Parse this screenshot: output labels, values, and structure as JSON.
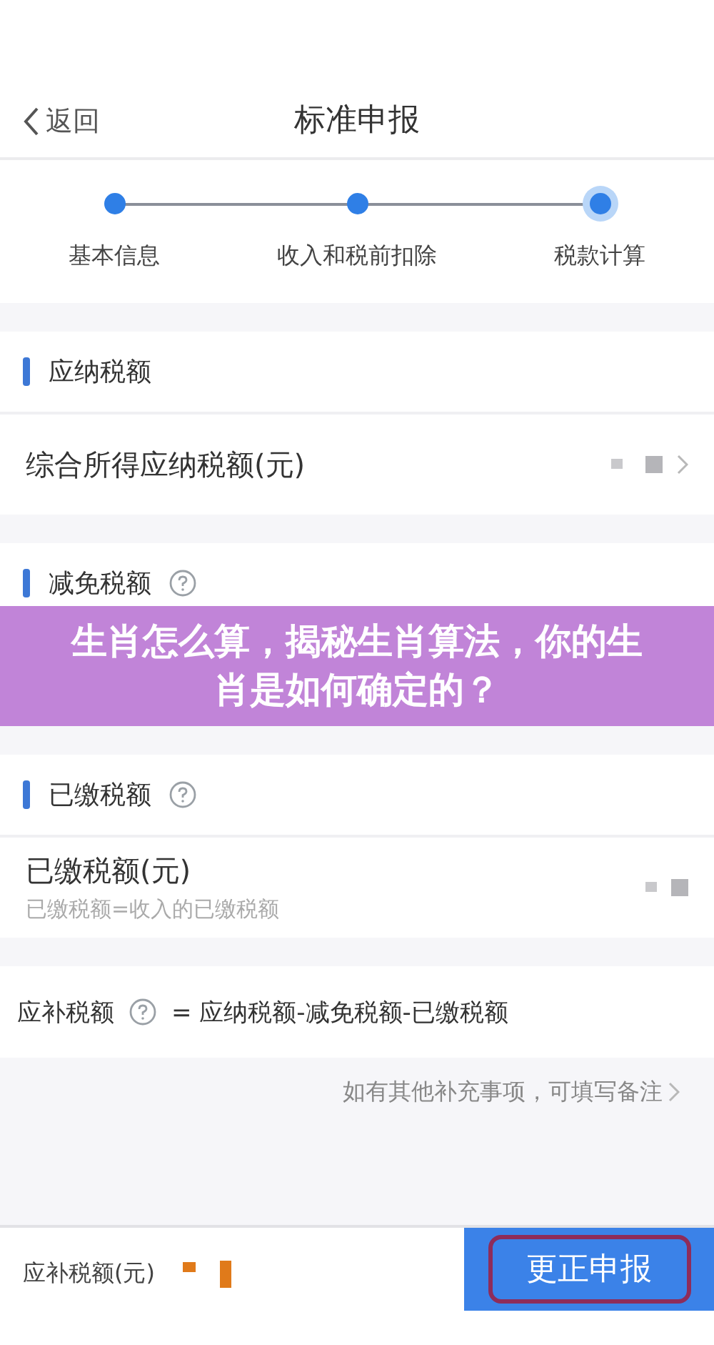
{
  "header": {
    "back": "返回",
    "title": "标准申报"
  },
  "steps": [
    {
      "label": "基本信息",
      "selected": false
    },
    {
      "label": "收入和税前扣除",
      "selected": false
    },
    {
      "label": "税款计算",
      "selected": true
    }
  ],
  "sections": [
    {
      "title": "应纳税额",
      "help": false,
      "rows": [
        {
          "label": "综合所得应纳税额(元)",
          "chevron": true
        }
      ]
    },
    {
      "title": "减免税额",
      "help": true
    },
    {
      "title": "已缴税额",
      "help": true,
      "rows": [
        {
          "label": "已缴税额(元)",
          "hint": "已缴税额=收入的已缴税额",
          "chevron": false
        }
      ]
    }
  ],
  "formula": {
    "label": "应补税额",
    "text": "= 应纳税额-减免税额-已缴税额"
  },
  "note": "如有其他补充事项，可填写备注",
  "footer": {
    "label": "应补税额(元)",
    "button": "更正申报"
  },
  "banner": {
    "text": "生肖怎么算，揭秘生肖算法，你的生肖是如何确定的？"
  }
}
